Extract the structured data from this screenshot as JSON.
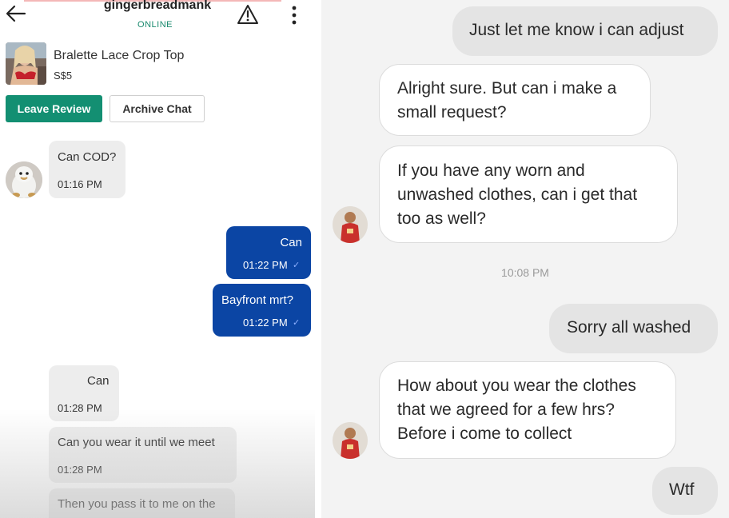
{
  "left_chat": {
    "header": {
      "username": "gingerbreadmank",
      "status": "ONLINE"
    },
    "product": {
      "name": "Bralette Lace Crop Top",
      "price": "S$5"
    },
    "actions": {
      "leave_review": "Leave Review",
      "archive_chat": "Archive Chat"
    },
    "messages": [
      {
        "text": "Can COD?",
        "time": "01:16 PM",
        "direction": "incoming"
      },
      {
        "text": "Can",
        "time": "01:22 PM",
        "direction": "outgoing"
      },
      {
        "text": "Bayfront mrt?",
        "time": "01:22 PM",
        "direction": "outgoing"
      },
      {
        "text": "Can",
        "time": "01:28 PM",
        "direction": "incoming"
      },
      {
        "text": "Can you wear it until we meet",
        "time": "01:28 PM",
        "direction": "incoming"
      },
      {
        "text": "Then you pass it to me on the",
        "direction": "incoming"
      }
    ],
    "colors": {
      "accent": "#138f72",
      "outgoing_bubble": "#0b45a4",
      "incoming_bubble": "#ededed"
    }
  },
  "right_chat": {
    "messages": [
      {
        "lines": [
          "Just let me know i can adjust"
        ],
        "direction": "outgoing"
      },
      {
        "lines": [
          "Alright sure. But can i make a",
          "small request?"
        ],
        "direction": "incoming"
      },
      {
        "lines": [
          "If you have any worn and",
          "unwashed clothes, can i get that",
          "too as well?"
        ],
        "direction": "incoming"
      },
      {
        "lines": [
          "Sorry all washed"
        ],
        "direction": "outgoing"
      },
      {
        "lines": [
          "How about you wear the clothes",
          "that we agreed for a few hrs?",
          "Before i come to collect"
        ],
        "direction": "incoming"
      },
      {
        "lines": [
          "Wtf"
        ],
        "direction": "outgoing"
      }
    ],
    "timestamp": "10:08 PM"
  }
}
